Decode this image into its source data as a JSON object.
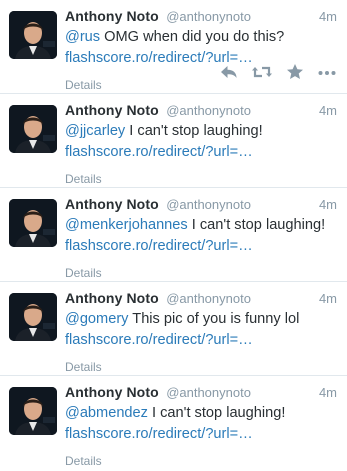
{
  "tweets": [
    {
      "author": "Anthony Noto",
      "handle": "@anthonynoto",
      "time": "4m",
      "mention": "@rus",
      "text": " OMG when did you do this?",
      "link": "flashscore.ro/redirect/?url=…",
      "details": "Details",
      "show_actions": true
    },
    {
      "author": "Anthony Noto",
      "handle": "@anthonynoto",
      "time": "4m",
      "mention": "@jjcarley",
      "text": " I can't stop laughing!",
      "link": "flashscore.ro/redirect/?url=…",
      "details": "Details"
    },
    {
      "author": "Anthony Noto",
      "handle": "@anthonynoto",
      "time": "4m",
      "mention": "@menkerjohannes",
      "text": " I can't stop laughing!",
      "link": "flashscore.ro/redirect/?url=…",
      "details": "Details"
    },
    {
      "author": "Anthony Noto",
      "handle": "@anthonynoto",
      "time": "4m",
      "mention": "@gomery",
      "text": " This pic of you is funny lol",
      "link": "flashscore.ro/redirect/?url=…",
      "details": "Details"
    },
    {
      "author": "Anthony Noto",
      "handle": "@anthonynoto",
      "time": "4m",
      "mention": "@abmendez",
      "text": " I can't stop laughing!",
      "link": "flashscore.ro/redirect/?url=…",
      "details": "Details"
    }
  ],
  "actions": [
    {
      "name": "reply-icon"
    },
    {
      "name": "retweet-icon"
    },
    {
      "name": "favorite-star-icon"
    },
    {
      "name": "more-options-icon"
    }
  ],
  "colors": {
    "link": "#2b7bb9",
    "muted": "#8899a6",
    "text": "#292f33",
    "action_icon": "#8899a6"
  }
}
